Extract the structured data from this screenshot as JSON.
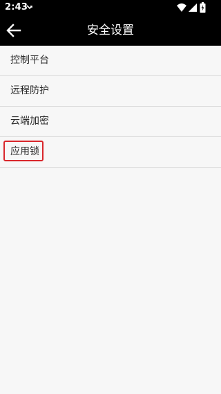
{
  "status_bar": {
    "time": "2:43",
    "icons": [
      "notification-icon",
      "wifi-icon",
      "signal-icon",
      "battery-icon"
    ]
  },
  "app_bar": {
    "title": "安全设置",
    "back_icon": "back-arrow-icon"
  },
  "settings_list": {
    "items": [
      {
        "label": "控制平台",
        "highlighted": false
      },
      {
        "label": "远程防护",
        "highlighted": false
      },
      {
        "label": "云端加密",
        "highlighted": false
      },
      {
        "label": "应用锁",
        "highlighted": true
      }
    ]
  },
  "colors": {
    "bar_background": "#000000",
    "page_background": "#f7f7f7",
    "divider": "#d8d8d8",
    "highlight": "#d9262b",
    "text": "#2b2b2b"
  }
}
